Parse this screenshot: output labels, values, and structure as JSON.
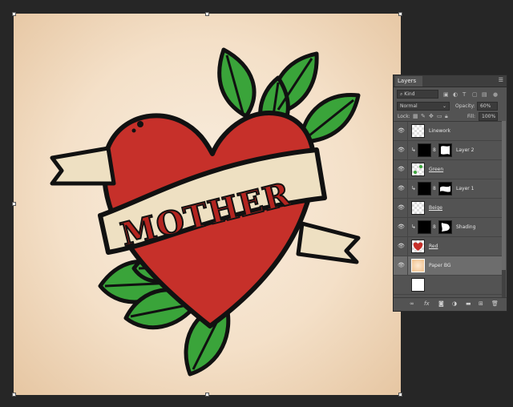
{
  "canvas": {
    "banner_text": "MOTHER",
    "colors": {
      "paper": "#f4e0c8",
      "heart": "#c6302a",
      "leaf": "#3aa43a",
      "banner": "#eee0c2",
      "line": "#111111"
    }
  },
  "layers_panel": {
    "tab_label": "Layers",
    "menu_icon": "panel-menu-icon",
    "filter": {
      "placeholder": "Kind"
    },
    "blend_mode": "Normal",
    "opacity_label": "Opacity:",
    "opacity_value": "60%",
    "lock_label": "Lock:",
    "fill_label": "Fill:",
    "fill_value": "100%",
    "layers": [
      {
        "name": "Linework",
        "visible": true,
        "type": "normal"
      },
      {
        "name": "Layer 2",
        "visible": true,
        "type": "adjustment-clipped"
      },
      {
        "name": "Green",
        "visible": true,
        "type": "normal"
      },
      {
        "name": "Layer 1",
        "visible": true,
        "type": "adjustment-clipped"
      },
      {
        "name": "Beige",
        "visible": true,
        "type": "normal"
      },
      {
        "name": "Shading",
        "visible": true,
        "type": "adjustment-clipped"
      },
      {
        "name": "Red",
        "visible": true,
        "type": "normal"
      },
      {
        "name": "Paper BG",
        "visible": true,
        "type": "normal",
        "selected": true
      }
    ],
    "footer_icons": [
      "link-icon",
      "fx-icon",
      "mask-icon",
      "adjustment-icon",
      "folder-icon",
      "new-layer-icon",
      "trash-icon"
    ]
  }
}
